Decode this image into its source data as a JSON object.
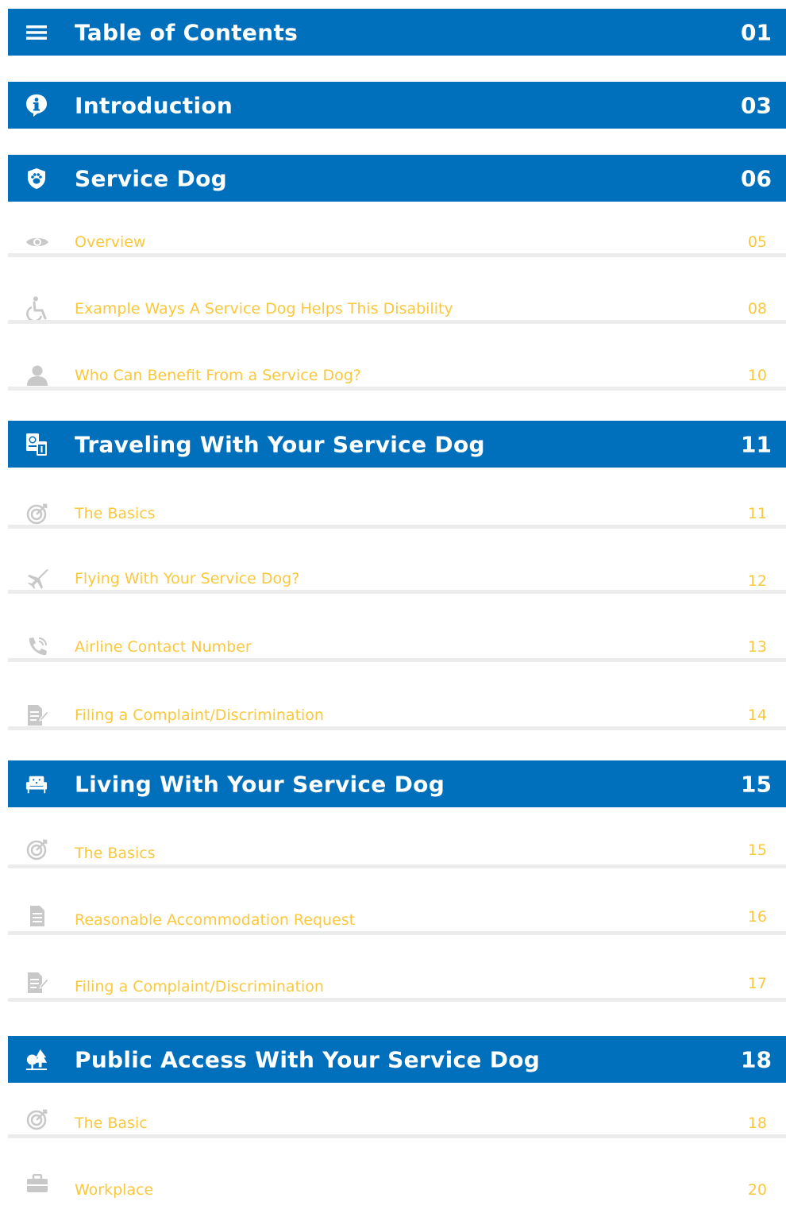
{
  "sections": [
    {
      "title": "Table of Contents",
      "page": "01",
      "icon": "menu-icon"
    },
    {
      "title": "Introduction",
      "page": "03",
      "icon": "info-icon"
    },
    {
      "title": "Service Dog",
      "page": "06",
      "icon": "paw-shield-icon",
      "items": [
        {
          "title": "Overview",
          "page": "05",
          "icon": "eye-icon"
        },
        {
          "title": "Example Ways A Service Dog Helps This Disability",
          "page": "08",
          "icon": "wheelchair-icon"
        },
        {
          "title": "Who Can Benefit From a Service Dog?",
          "page": "10",
          "icon": "user-icon"
        }
      ]
    },
    {
      "title": "Traveling With Your Service Dog",
      "page": "11",
      "icon": "passport-icon",
      "items": [
        {
          "title": "The Basics",
          "page": "11",
          "icon": "target-icon"
        },
        {
          "title": "Flying With Your Service Dog?",
          "page": "12",
          "icon": "airplane-icon"
        },
        {
          "title": "Airline Contact Number",
          "page": "13",
          "icon": "phone-icon"
        },
        {
          "title": "Filing a Complaint/Discrimination",
          "page": "14",
          "icon": "edit-document-icon"
        }
      ]
    },
    {
      "title": "Living With Your Service Dog",
      "page": "15",
      "icon": "armchair-icon",
      "items": [
        {
          "title": "The Basics",
          "page": "15",
          "icon": "target-icon"
        },
        {
          "title": "Reasonable Accommodation Request",
          "page": "16",
          "icon": "document-icon"
        },
        {
          "title": "Filing a Complaint/Discrimination",
          "page": "17",
          "icon": "edit-document-icon"
        }
      ]
    },
    {
      "title": "Public Access With Your Service Dog",
      "page": "18",
      "icon": "trees-icon",
      "items": [
        {
          "title": "The Basic",
          "page": "18",
          "icon": "target-icon"
        },
        {
          "title": "Workplace",
          "page": "20",
          "icon": "briefcase-icon"
        }
      ]
    }
  ],
  "colors": {
    "header_bg": "#0070bd",
    "sub_text": "#fac83c",
    "icon_gray": "#c8c8c8"
  }
}
